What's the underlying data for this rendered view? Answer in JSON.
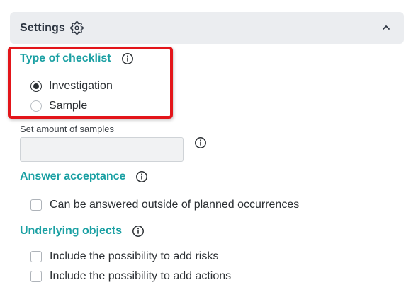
{
  "settings": {
    "title": "Settings",
    "icon": "gear-icon",
    "collapse_icon": "chevron-up-icon"
  },
  "checklist_type": {
    "title": "Type of checklist",
    "options": [
      {
        "label": "Investigation",
        "selected": true
      },
      {
        "label": "Sample",
        "selected": false
      }
    ]
  },
  "samples": {
    "label": "Set amount of samples",
    "value": "",
    "placeholder": ""
  },
  "answer_acceptance": {
    "title": "Answer acceptance",
    "options": [
      {
        "label": "Can be answered outside of planned occurrences",
        "checked": false
      }
    ]
  },
  "underlying_objects": {
    "title": "Underlying objects",
    "options": [
      {
        "label": "Include the possibility to add risks",
        "checked": false
      },
      {
        "label": "Include the possibility to add actions",
        "checked": false
      }
    ]
  },
  "colors": {
    "accent": "#1aa0a3",
    "highlight": "#e3151a",
    "header_bg": "#ebedf0"
  }
}
